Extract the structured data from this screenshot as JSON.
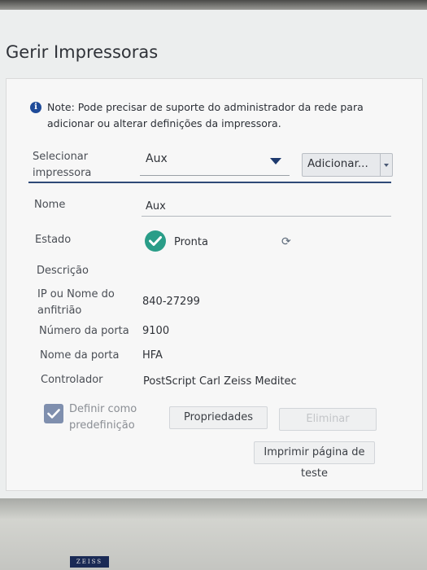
{
  "window": {
    "title": "Gerir Impressoras"
  },
  "note": {
    "text": "Note: Pode precisar de suporte do administrador da rede para adicionar ou alterar definições da impressora."
  },
  "select_printer": {
    "label": "Selecionar impressora",
    "value": "Aux",
    "add_button": "Adicionar..."
  },
  "details": {
    "name_label": "Nome",
    "name_value": "Aux",
    "status_label": "Estado",
    "status_value": "Pronta",
    "status_color": "#2a9d88",
    "description_label": "Descrição",
    "ip_label": "IP ou Nome do anfitrião",
    "ip_value": "840-27299",
    "port_number_label": "Número da porta",
    "port_number_value": "9100",
    "port_name_label": "Nome da porta",
    "port_name_value": "HFA",
    "driver_label": "Controlador",
    "driver_value": "PostScript Carl Zeiss Meditec"
  },
  "default_checkbox": {
    "label": "Definir como predefinição",
    "checked": true
  },
  "buttons": {
    "properties": "Propriedades",
    "delete": "Eliminar",
    "print_test": "Imprimir página de teste"
  },
  "brand": {
    "logo_text": "ZEISS"
  },
  "icons": {
    "info": "info-icon",
    "status": "check-circle-icon",
    "refresh": "refresh-icon",
    "dropdown": "chevron-down-icon"
  },
  "colors": {
    "accent": "#2f4a78",
    "info": "#1f4b99",
    "checkbox": "#7f8fae"
  }
}
